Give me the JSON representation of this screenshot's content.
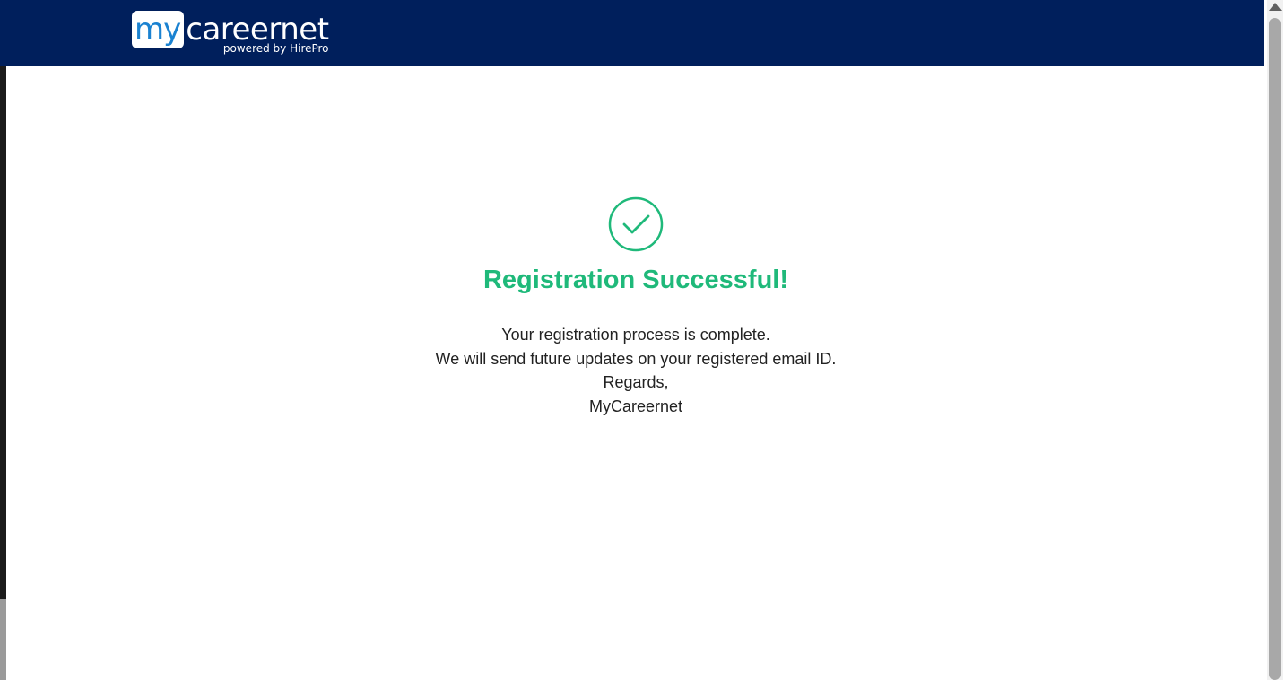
{
  "header": {
    "logo": {
      "my": "my",
      "careernet": "careernet",
      "tagline": "powered by HirePro"
    },
    "background_color": "#001f5c"
  },
  "confirmation": {
    "icon": "check-circle-icon",
    "icon_color": "#1fb97a",
    "title": "Registration Successful!",
    "lines": [
      "Your registration process is complete.",
      "We will send future updates on your registered email ID.",
      "Regards,",
      "MyCareernet"
    ]
  },
  "colors": {
    "accent": "#1fb97a",
    "brand_blue": "#1a82d1",
    "header": "#001f5c"
  }
}
